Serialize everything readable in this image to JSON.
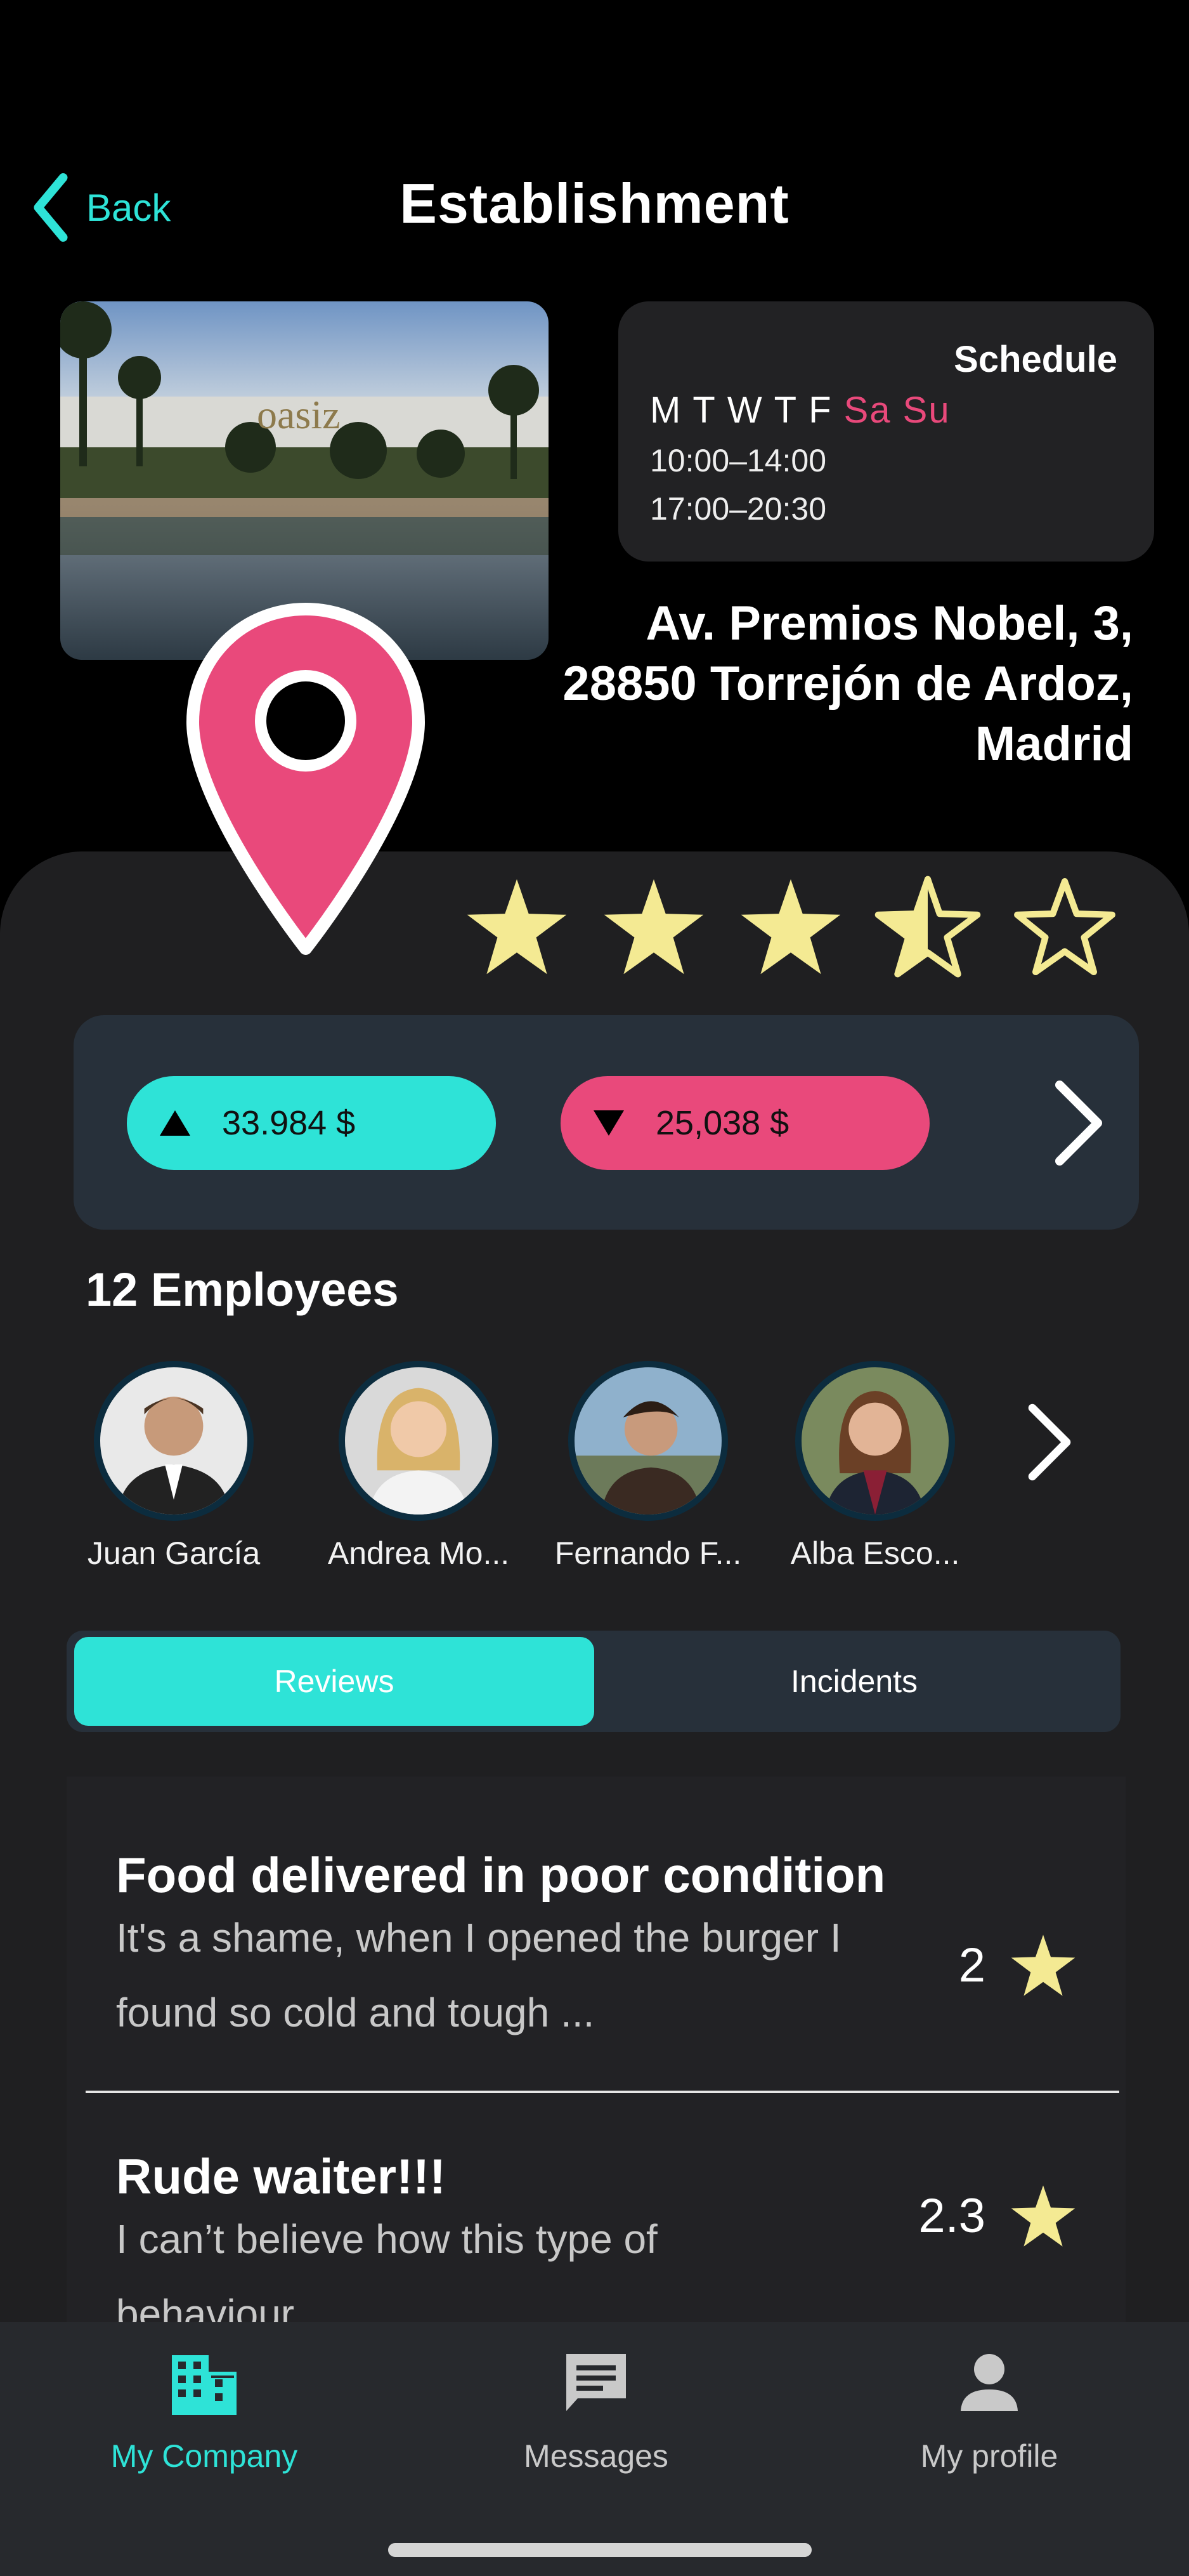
{
  "header": {
    "back_label": "Back",
    "title": "Establishment"
  },
  "photo": {
    "sign_text": "oasiz"
  },
  "schedule": {
    "title": "Schedule",
    "weekdays": "M T W T F",
    "weekend": "Sa Su",
    "hours": [
      "10:00–14:00",
      "17:00–20:30"
    ]
  },
  "address": "Av. Premios Nobel, 3, 28850 Torrejón de Ardoz, Madrid",
  "rating": {
    "stars": 3.5,
    "max": 5
  },
  "finance": {
    "income": "33.984 $",
    "expenses": "25,038 $"
  },
  "employees": {
    "title": "12 Employees",
    "list": [
      {
        "name": "Juan García"
      },
      {
        "name": "Andrea Mo..."
      },
      {
        "name": "Fernando F..."
      },
      {
        "name": "Alba Esco..."
      }
    ]
  },
  "tabs": {
    "reviews": "Reviews",
    "incidents": "Incidents"
  },
  "reviews": [
    {
      "title": "Food delivered in poor condition",
      "text": "It's a shame, when I opened the burger I found so cold and tough ...",
      "rating": "2"
    },
    {
      "title": "Rude waiter!!!",
      "text": "I can’t believe how this type of behaviour",
      "rating": "2.3"
    }
  ],
  "nav": {
    "company": "My Company",
    "messages": "Messages",
    "profile": "My profile"
  },
  "colors": {
    "accent": "#2ee3d7",
    "pink": "#e9497b",
    "star": "#f4ea93",
    "background": "#000000",
    "sheet": "#1f1f21"
  }
}
